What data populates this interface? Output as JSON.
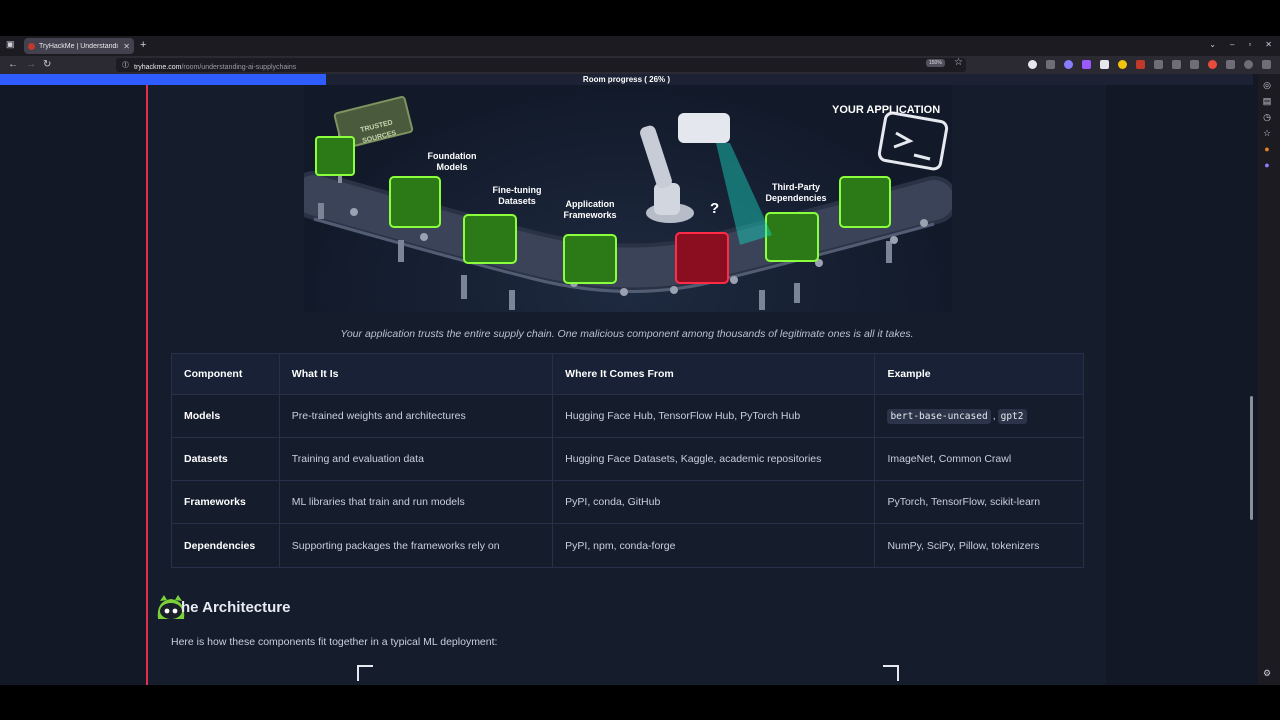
{
  "browser": {
    "tab_title": "TryHackMe | Understandi",
    "url_host": "tryhackme.com",
    "url_path": "/room/understanding-ai-supplychains",
    "zoom": "150%"
  },
  "progress": {
    "label": "Room progress ( 26% )",
    "fraction": 0.26
  },
  "hero": {
    "labels": {
      "trusted_sources": "TRUSTED SOURCES",
      "foundation_models": "Foundation Models",
      "finetuning_datasets": "Fine-tuning Datasets",
      "application_frameworks": "Application Frameworks",
      "third_party": "Third-Party Dependencies",
      "your_application": "YOUR APPLICATION",
      "question": "?"
    }
  },
  "caption": "Your application trusts the entire supply chain. One malicious component among thousands of legitimate ones is all it takes.",
  "table": {
    "headers": [
      "Component",
      "What It Is",
      "Where It Comes From",
      "Example"
    ],
    "rows": [
      {
        "component": "Models",
        "what": "Pre-trained weights and architectures",
        "where": "Hugging Face Hub, TensorFlow Hub, PyTorch Hub",
        "example_code": [
          "bert-base-uncased",
          "gpt2"
        ]
      },
      {
        "component": "Datasets",
        "what": "Training and evaluation data",
        "where": "Hugging Face Datasets, Kaggle, academic repositories",
        "example": "ImageNet, Common Crawl"
      },
      {
        "component": "Frameworks",
        "what": "ML libraries that train and run models",
        "where": "PyPI, conda, GitHub",
        "example": "PyTorch, TensorFlow, scikit-learn"
      },
      {
        "component": "Dependencies",
        "what": "Supporting packages the frameworks rely on",
        "where": "PyPI, npm, conda-forge",
        "example": "NumPy, SciPy, Pillow, tokenizers"
      }
    ]
  },
  "section": {
    "title": "he Architecture",
    "intro": "Here is how these components fit together in a typical ML deployment:"
  },
  "colors": {
    "accent_blue": "#2e5cff",
    "accent_red": "#e0304d",
    "box_green": "#7cff2f",
    "box_red": "#ff1f3a"
  }
}
